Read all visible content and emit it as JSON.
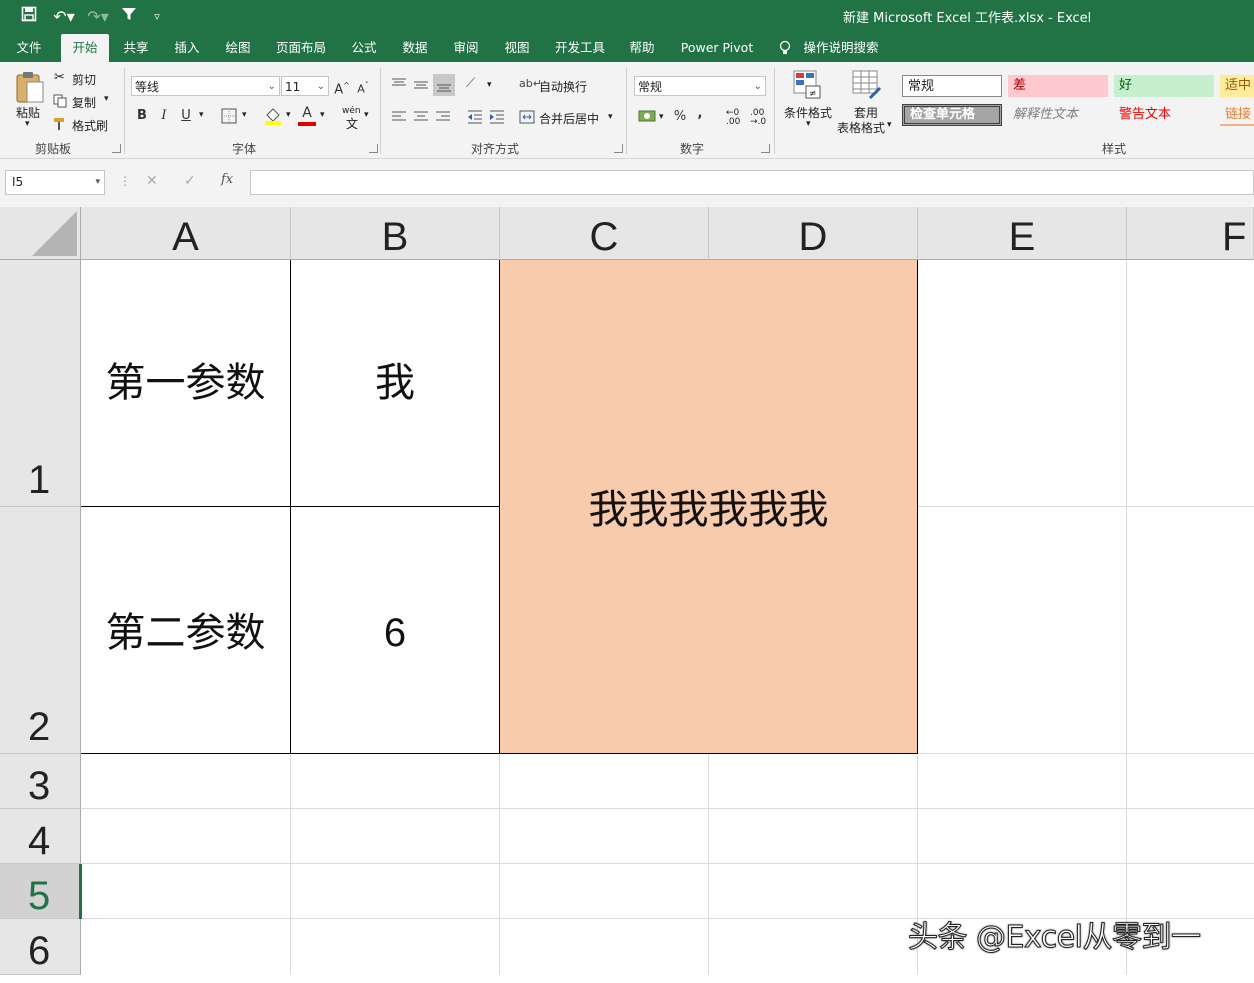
{
  "window": {
    "title": "新建 Microsoft Excel 工作表.xlsx  -  Excel"
  },
  "ribbon_tabs": [
    "文件",
    "开始",
    "共享",
    "插入",
    "绘图",
    "页面布局",
    "公式",
    "数据",
    "审阅",
    "视图",
    "开发工具",
    "帮助",
    "Power Pivot",
    "操作说明搜索"
  ],
  "clipboard": {
    "paste": "粘贴",
    "cut": "剪切",
    "copy": "复制",
    "format_painter": "格式刷",
    "label": "剪贴板"
  },
  "font": {
    "name": "等线",
    "size": "11",
    "label": "字体",
    "bold": "B",
    "italic": "I",
    "underline": "U",
    "grow": "A",
    "shrink": "A",
    "phonetic": "wén",
    "text_color": "#e00000",
    "fill_color": "#ffff00"
  },
  "alignment": {
    "wrap": "自动换行",
    "merge": "合并后居中",
    "label": "对齐方式"
  },
  "number": {
    "format": "常规",
    "percent": "%",
    "comma": ",",
    "label": "数字"
  },
  "styles": {
    "conditional": "条件格式",
    "table_line1": "套用",
    "table_line2": "表格格式",
    "label": "样式",
    "normal": "常规",
    "bad": "差",
    "good": "好",
    "neutral": "适中",
    "check_cell": "检查单元格",
    "explanatory": "解释性文本",
    "warning": "警告文本",
    "link": "链接"
  },
  "formula_bar": {
    "name_box": "I5",
    "cancel": "✕",
    "enter": "✓",
    "fx": "fx",
    "content": ""
  },
  "columns": [
    "A",
    "B",
    "C",
    "D",
    "E",
    "F"
  ],
  "rows": [
    "1",
    "2",
    "3",
    "4",
    "5",
    "6"
  ],
  "cells": {
    "A1": "第一参数",
    "B1": "我",
    "C1": "我我我我我我",
    "A2": "第二参数",
    "B2": "6"
  },
  "colors": {
    "title_green": "#217346",
    "merged_fill": "#f8cbad",
    "selected_row": "#d2d2d2"
  },
  "watermark": "头条 @Excel从零到一"
}
